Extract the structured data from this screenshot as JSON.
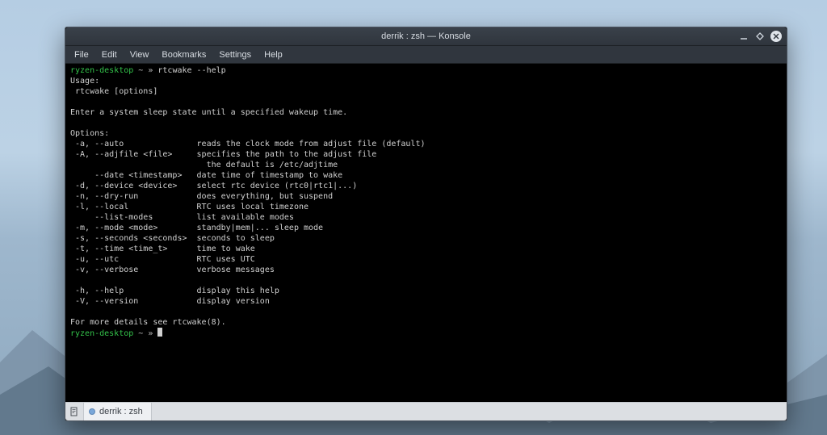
{
  "window": {
    "title": "derrik : zsh — Konsole"
  },
  "menubar": {
    "items": [
      "File",
      "Edit",
      "View",
      "Bookmarks",
      "Settings",
      "Help"
    ]
  },
  "terminal": {
    "prompt1": {
      "host": "ryzen-desktop",
      "path": " ~ »",
      "command": " rtcwake --help"
    },
    "body": "\nUsage:\n rtcwake [options]\n\nEnter a system sleep state until a specified wakeup time.\n\nOptions:\n -a, --auto               reads the clock mode from adjust file (default)\n -A, --adjfile <file>     specifies the path to the adjust file\n                            the default is /etc/adjtime\n     --date <timestamp>   date time of timestamp to wake\n -d, --device <device>    select rtc device (rtc0|rtc1|...)\n -n, --dry-run            does everything, but suspend\n -l, --local              RTC uses local timezone\n     --list-modes         list available modes\n -m, --mode <mode>        standby|mem|... sleep mode\n -s, --seconds <seconds>  seconds to sleep\n -t, --time <time_t>      time to wake\n -u, --utc                RTC uses UTC\n -v, --verbose            verbose messages\n\n -h, --help               display this help\n -V, --version            display version\n\nFor more details see rtcwake(8).",
    "prompt2": {
      "host": "ryzen-desktop",
      "path": " ~ » "
    }
  },
  "tabbar": {
    "newtab_label": "+",
    "tab_label": "derrik : zsh"
  }
}
